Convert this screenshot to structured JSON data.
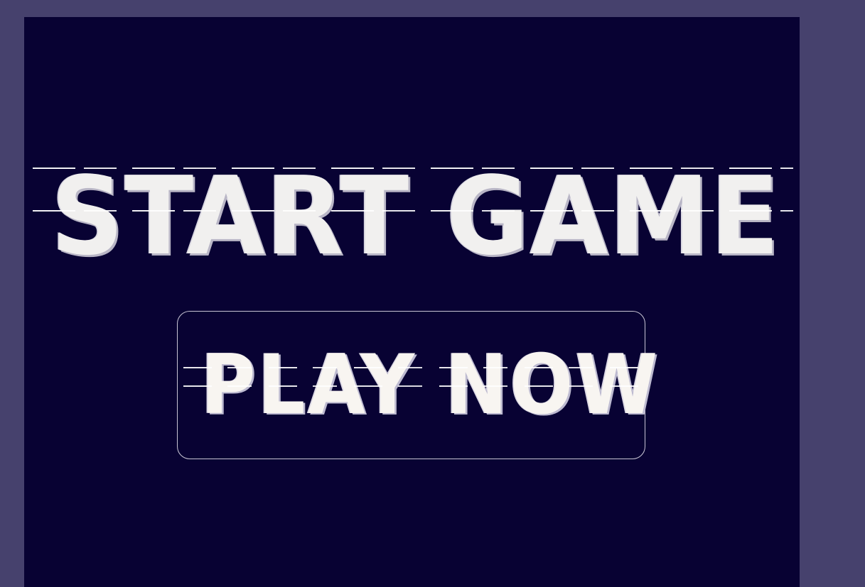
{
  "colors": {
    "outer_background": "#46416d",
    "panel_background": "#080233",
    "text": "#f1f0ef",
    "button_border": "#c8c5d4"
  },
  "screen": {
    "title": "START GAME",
    "play_button_label": "PLAY NOW"
  }
}
